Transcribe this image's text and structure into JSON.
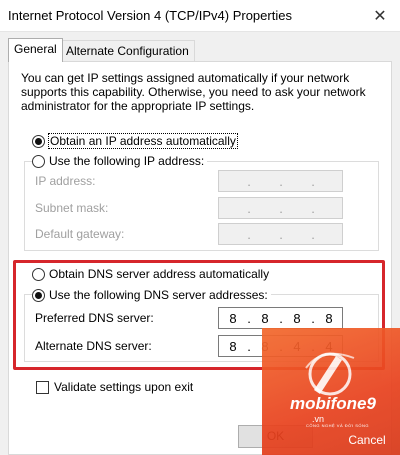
{
  "window": {
    "title": "Internet Protocol Version 4 (TCP/IPv4) Properties",
    "close_glyph": "✕"
  },
  "tabs": [
    {
      "label": "General"
    },
    {
      "label": "Alternate Configuration"
    }
  ],
  "description": "You can get IP settings assigned automatically if your network supports this capability. Otherwise, you need to ask your network administrator for the appropriate IP settings.",
  "ip": {
    "auto_label": "Obtain an IP address automatically",
    "manual_label": "Use the following IP address:",
    "fields": [
      {
        "label": "IP address:",
        "value": [
          "",
          "",
          "",
          ""
        ]
      },
      {
        "label": "Subnet mask:",
        "value": [
          "",
          "",
          "",
          ""
        ]
      },
      {
        "label": "Default gateway:",
        "value": [
          "",
          "",
          "",
          ""
        ]
      }
    ]
  },
  "dns": {
    "auto_label": "Obtain DNS server address automatically",
    "manual_label": "Use the following DNS server addresses:",
    "preferred": {
      "label": "Preferred DNS server:",
      "octets": [
        "8",
        "8",
        "8",
        "8"
      ]
    },
    "alternate": {
      "label": "Alternate DNS server:",
      "octets": [
        "8",
        "8",
        "4",
        "4"
      ]
    }
  },
  "validate_label": "Validate settings upon exit",
  "buttons": {
    "ok": "OK",
    "cancel": "Cancel"
  },
  "watermark": {
    "brand": "mobifone9",
    "domain": ".vn",
    "tagline": "CÔNG NGHỆ VÀ ĐỜI SỐNG"
  },
  "colors": {
    "highlight_border": "#d6262b",
    "watermark": "#f36a2e"
  }
}
